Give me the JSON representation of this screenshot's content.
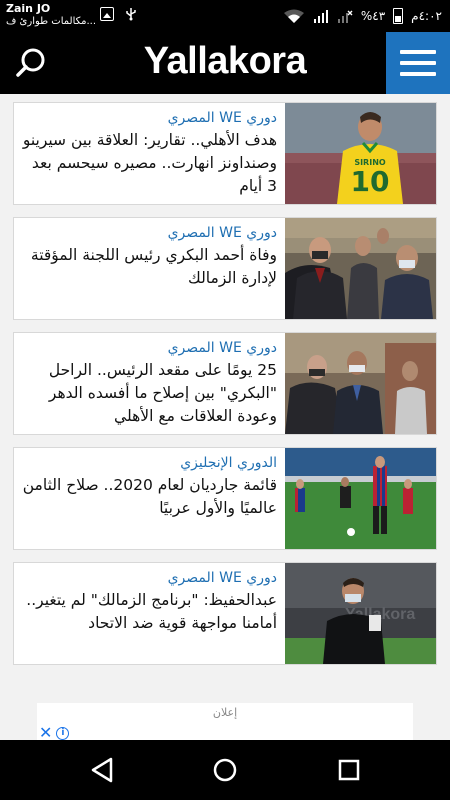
{
  "status_bar": {
    "carrier": "Zain JO",
    "notification": "مكالمات طوارئ ف...",
    "time": "٤:٠٢م",
    "battery": "%٤٣"
  },
  "header": {
    "logo": "Yallakora"
  },
  "articles": [
    {
      "category": "دوري WE المصري",
      "title": "هدف الأهلي.. تقارير: العلاقة بين سيرينو وصنداونز انهارت.. مصيره سيحسم بعد 3 أيام",
      "image": "player-yellow-jersey-photo"
    },
    {
      "category": "دوري WE المصري",
      "title": "وفاة أحمد البكري رئيس اللجنة المؤقتة لإدارة الزمالك",
      "image": "officials-in-masks-photo"
    },
    {
      "category": "دوري WE المصري",
      "title": "25 يومًا على مقعد الرئيس.. الراحل \"البكري\" بين إصلاح ما أفسده الدهر وعودة العلاقات مع الأهلي",
      "image": "officials-walking-photo"
    },
    {
      "category": "الدوري الإنجليزي",
      "title": "قائمة جارديان لعام 2020.. صلاح الثامن عالميًا والأول عربيًا",
      "image": "football-match-photo"
    },
    {
      "category": "دوري WE المصري",
      "title": "عبدالحفيظ: \"برنامج الزمالك\" لم يتغير.. أمامنا مواجهة قوية ضد الاتحاد",
      "image": "official-in-mask-photo"
    }
  ],
  "ad": {
    "label": "إعلان"
  },
  "nav": {
    "back_icon": "back-icon",
    "home_icon": "home-icon",
    "recents_icon": "recents-icon"
  }
}
